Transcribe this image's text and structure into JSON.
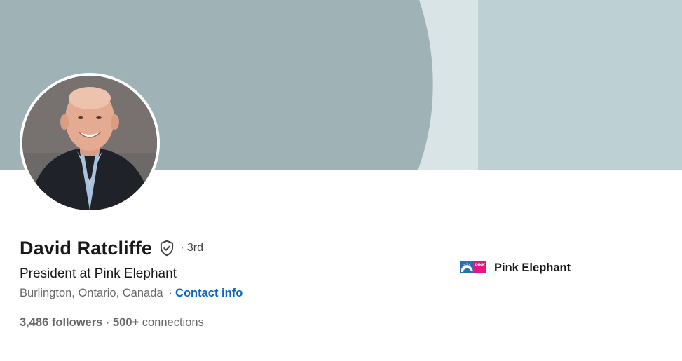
{
  "banner": {
    "colors": [
      "#9fb2b6",
      "#d9e4e6",
      "#bdd1d5"
    ]
  },
  "profile": {
    "name": "David Ratcliffe",
    "verified_icon": "shield-check-icon",
    "degree": "· 3rd",
    "headline": "President at Pink Elephant",
    "location": "Burlington, Ontario, Canada",
    "location_separator": "·",
    "contact_info_label": "Contact info",
    "followers": "3,486 followers",
    "stats_separator": " · ",
    "connections_count": "500+",
    "connections_label": " connections"
  },
  "company": {
    "name": "Pink Elephant",
    "logo_text": "PINK",
    "logo_colors": [
      "#2c6db4",
      "#e6157f"
    ]
  },
  "colors": {
    "link": "#0a66c2",
    "text_primary": "rgba(0,0,0,0.9)",
    "text_secondary": "rgba(0,0,0,0.6)"
  }
}
